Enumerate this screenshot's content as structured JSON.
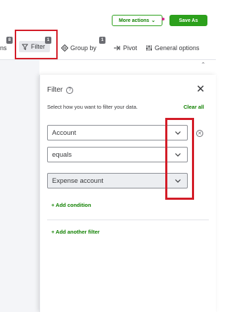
{
  "header": {
    "more_actions_label": "More actions",
    "save_as_label": "Save As"
  },
  "toolbar": {
    "cut_label": "ns",
    "cut_badge": "8",
    "filter_label": "Filter",
    "filter_badge": "1",
    "group_by_label": "Group by",
    "group_by_badge": "1",
    "pivot_label": "Pivot",
    "general_options_label": "General options"
  },
  "filter_panel": {
    "title": "Filter",
    "description": "Select how you want to filter your data.",
    "clear_all_label": "Clear all",
    "field_value": "Account",
    "operator_value": "equals",
    "value_value": "Expense account",
    "add_condition_label": "+ Add condition",
    "add_another_filter_label": "+ Add another filter"
  },
  "colors": {
    "accent_green": "#2ca01c",
    "link_green": "#108000",
    "highlight_red": "#d31c27"
  }
}
